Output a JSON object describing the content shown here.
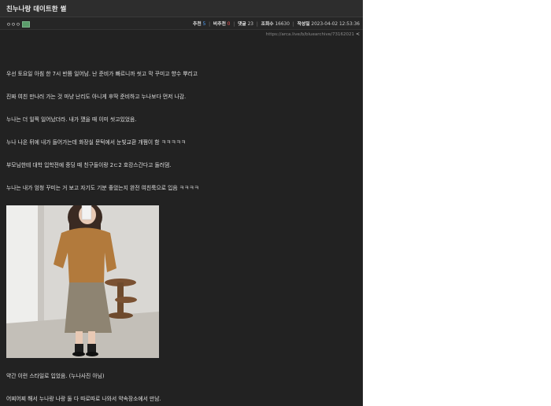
{
  "post": {
    "title": "친누나랑 데이트한 썰",
    "author": "ㅇㅇㅇ",
    "stats": {
      "upvote_label": "추천",
      "upvote_value": "5",
      "downvote_label": "비추천",
      "downvote_value": "0",
      "comments_label": "댓글",
      "comments_value": "23",
      "views_label": "조회수",
      "views_value": "16630",
      "date_label": "작성일",
      "date_value": "2023-04-02 12:53:36"
    },
    "url": "https://arca.live/b/bluearchive/73162021",
    "paragraphs": [
      "우선 토요일 아침 한 7시 반쯤 일어남. 난 준비가 빠르니까 씻고 막 꾸미고 향수 뿌리고",
      "진짜 여친 만나러 가는 것 마냥 난리도 아니게 후딱 준비하고 누나보다 먼저 나감.",
      "누나는 더 일찍 일어났더라. 내가 깼을 때 이미 씻고있었음.",
      "누나 나온 뒤에 내가 들어가는데 화장실 문턱에서 눈빛교환 개쩜이 함 ㅋㅋㅋㅋㅋ",
      "부모님한테 대학 입학전에 중딩 때 친구들이랑 2ㄷ2 호캉스간다고 둘러댐.",
      "누나는 내가 엄청 꾸미는 거 보고 자기도 기분 좋았는지 완전 여친룩으로 입음 ㅋㅋㅋㅋ",
      "약간 이런 스타일로 입었음. (누나사진 아님)",
      "어찌어찌 해서 누나랑 나랑 둘 다 따로따로 나와서 약속장소에서 만남."
    ]
  },
  "colors": {
    "background": "#222222",
    "upvote": "#4da3ff",
    "downvote": "#ff5a5a"
  }
}
